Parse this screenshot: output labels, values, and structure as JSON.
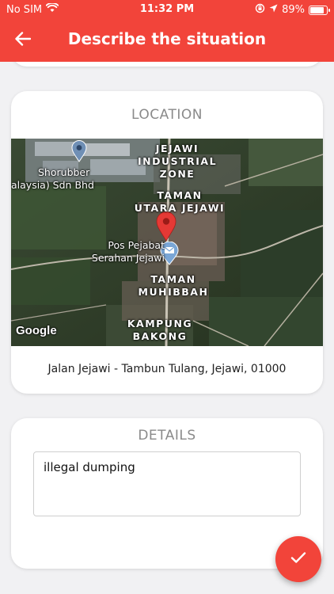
{
  "status_bar": {
    "carrier": "No SIM",
    "time": "11:32 PM",
    "battery": "89%",
    "battery_level": 0.89
  },
  "app_bar": {
    "title": "Describe the situation",
    "back_icon": "arrow-left-icon"
  },
  "location_card": {
    "title": "LOCATION",
    "address": "Jalan Jejawi - Tambun Tulang, Jejawi, 01000",
    "map": {
      "place_labels": {
        "jejawi_industrial_1": "JEJAWI",
        "jejawi_industrial_2": "INDUSTRIAL",
        "jejawi_industrial_3": "ZONE",
        "taman_utara_1": "TAMAN",
        "taman_utara_2": "UTARA JEJAWI",
        "pos_1": "Pos Pejabat",
        "pos_2": "Serahan Jejawi",
        "shorubber_1": "Shorubber",
        "shorubber_2": "alaysia) Sdn Bhd",
        "taman_muhibbah_1": "TAMAN",
        "taman_muhibbah_2": "MUHIBBAH",
        "kampung_bakong_1": "KAMPUNG",
        "kampung_bakong_2": "BAKONG"
      },
      "attribution": "Google"
    }
  },
  "details_card": {
    "title": "DETAILS",
    "value": "illegal dumping"
  },
  "fab": {
    "icon": "checkmark-icon"
  },
  "colors": {
    "accent": "#f2443a"
  }
}
